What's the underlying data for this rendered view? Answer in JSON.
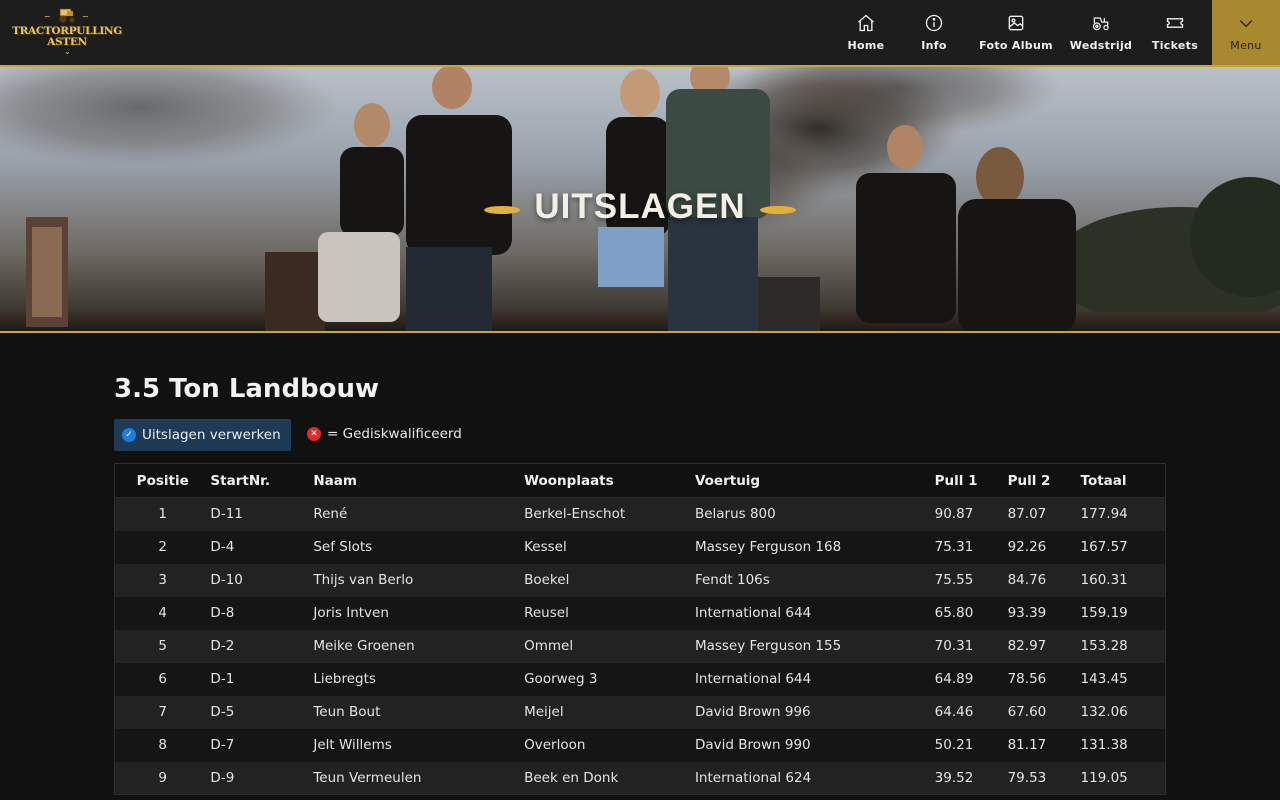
{
  "header": {
    "logo_line1": "TRACTORPULLING",
    "logo_line2": "ASTEN",
    "nav": [
      {
        "label": "Home",
        "icon": "home-icon"
      },
      {
        "label": "Info",
        "icon": "info-icon"
      },
      {
        "label": "Foto Album",
        "icon": "image-icon"
      },
      {
        "label": "Wedstrijd",
        "icon": "tractor-icon"
      },
      {
        "label": "Tickets",
        "icon": "ticket-icon"
      },
      {
        "label": "Menu",
        "icon": "chevron-down-icon"
      }
    ],
    "accent_color": "#c9a437"
  },
  "hero": {
    "title": "UITSLAGEN"
  },
  "main": {
    "heading": "3.5 Ton Landbouw",
    "process_button": "Uitslagen verwerken",
    "legend_text": "= Gediskwalificeerd",
    "table": {
      "headers": [
        "Positie",
        "StartNr.",
        "Naam",
        "Woonplaats",
        "Voertuig",
        "Pull 1",
        "Pull 2",
        "Totaal"
      ],
      "rows": [
        [
          "1",
          "D-11",
          "René",
          "Berkel-Enschot",
          "Belarus 800",
          "90.87",
          "87.07",
          "177.94"
        ],
        [
          "2",
          "D-4",
          "Sef Slots",
          "Kessel",
          "Massey Ferguson 168",
          "75.31",
          "92.26",
          "167.57"
        ],
        [
          "3",
          "D-10",
          "Thijs van Berlo",
          "Boekel",
          "Fendt 106s",
          "75.55",
          "84.76",
          "160.31"
        ],
        [
          "4",
          "D-8",
          "Joris Intven",
          "Reusel",
          "International 644",
          "65.80",
          "93.39",
          "159.19"
        ],
        [
          "5",
          "D-2",
          "Meike Groenen",
          "Ommel",
          "Massey Ferguson 155",
          "70.31",
          "82.97",
          "153.28"
        ],
        [
          "6",
          "D-1",
          "Liebregts",
          "Goorweg 3",
          "International 644",
          "64.89",
          "78.56",
          "143.45"
        ],
        [
          "7",
          "D-5",
          "Teun Bout",
          "Meijel",
          "David Brown 996",
          "64.46",
          "67.60",
          "132.06"
        ],
        [
          "8",
          "D-7",
          "Jelt Willems",
          "Overloon",
          "David Brown 990",
          "50.21",
          "81.17",
          "131.38"
        ],
        [
          "9",
          "D-9",
          "Teun Vermeulen",
          "Beek en Donk",
          "International 624",
          "39.52",
          "79.53",
          "119.05"
        ]
      ]
    }
  }
}
